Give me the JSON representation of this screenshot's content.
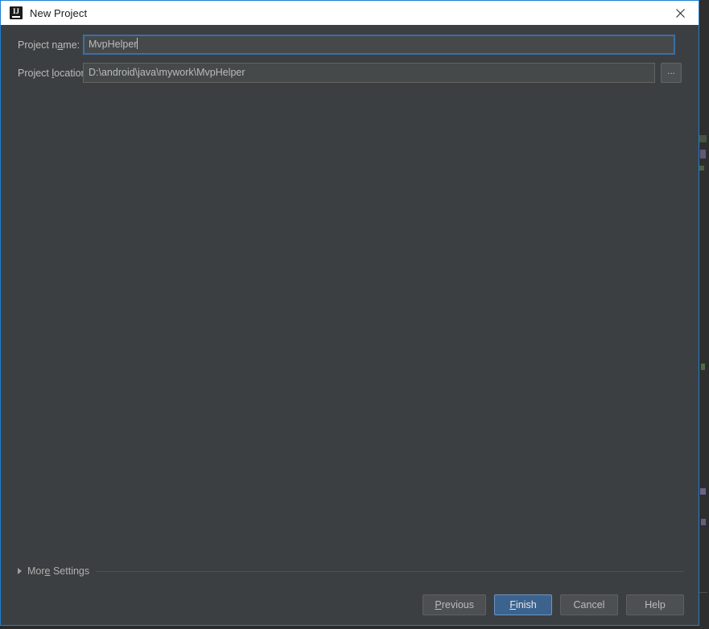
{
  "window": {
    "title": "New Project",
    "icon": "intellij-idea-icon",
    "icon_letters": "IJ",
    "close_icon": "close-icon",
    "border_color": "#1f7fd0",
    "titlebar_bg": "#ffffff",
    "body_bg": "#3c3f41"
  },
  "form": {
    "fields": [
      {
        "label_prefix": "Project n",
        "label_mnemonic": "a",
        "label_suffix": "me:",
        "name": "project-name",
        "value": "MvpHelper",
        "focused": true
      },
      {
        "label_prefix": "Project ",
        "label_mnemonic": "l",
        "label_suffix": "ocation:",
        "name": "project-location",
        "value": "D:\\android\\java\\mywork\\MvpHelper",
        "focused": false
      }
    ],
    "browse_button_label": "..."
  },
  "more_settings": {
    "label": "More Settings",
    "label_prefix": "Mor",
    "label_mnemonic": "e",
    "label_suffix": " Settings",
    "expanded": false,
    "triangle_icon": "chevron-right-icon"
  },
  "footer": {
    "buttons": [
      {
        "name": "previous",
        "prefix": "",
        "mnemonic": "P",
        "suffix": "revious",
        "primary": false
      },
      {
        "name": "finish",
        "prefix": "",
        "mnemonic": "F",
        "suffix": "inish",
        "primary": true
      },
      {
        "name": "cancel",
        "prefix": "Cancel",
        "mnemonic": "",
        "suffix": "",
        "primary": false
      },
      {
        "name": "help",
        "prefix": "Help",
        "mnemonic": "",
        "suffix": "",
        "primary": false
      }
    ],
    "primary_color": "#3c628e"
  }
}
